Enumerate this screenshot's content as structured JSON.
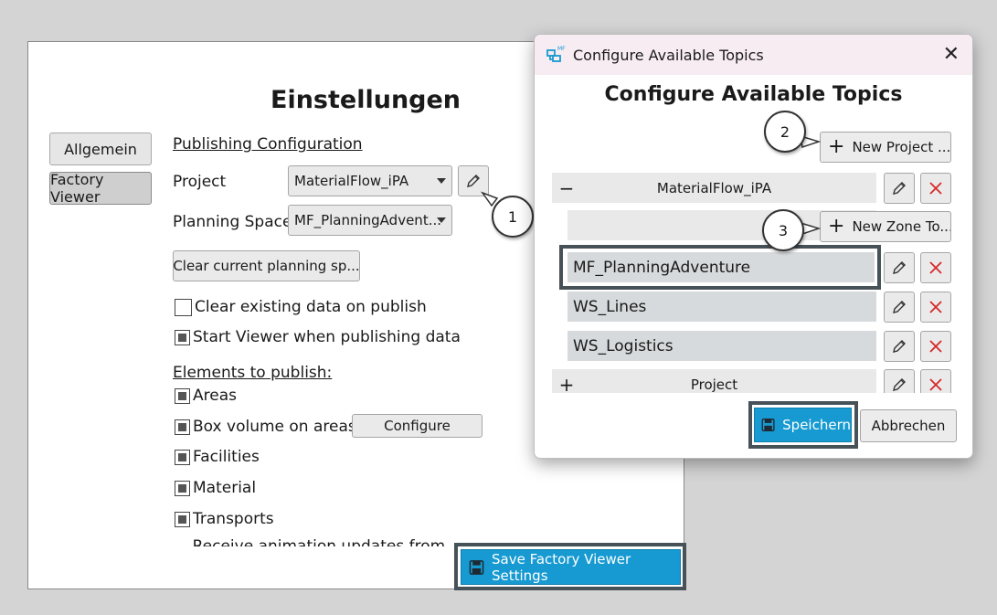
{
  "settings": {
    "title": "Einstellungen",
    "nav": [
      {
        "label": "Allgemein",
        "active": false
      },
      {
        "label": "Factory Viewer",
        "active": true
      }
    ],
    "publishing_header": "Publishing Configuration",
    "project_label": "Project",
    "project_value": "MaterialFlow_iPA",
    "planning_space_label": "Planning Space",
    "planning_space_value": "MF_PlanningAdvent...",
    "clear_planning_button": "Clear current planning sp...",
    "options": [
      {
        "label": "Clear existing data on publish",
        "checked": false
      },
      {
        "label": "Start Viewer when publishing data",
        "checked": true
      }
    ],
    "elements_header": "Elements to publish:",
    "elements": [
      {
        "label": "Areas",
        "checked": true
      },
      {
        "label": "Box volume on areas",
        "checked": true
      },
      {
        "label": "Facilities",
        "checked": true
      },
      {
        "label": "Material",
        "checked": true
      },
      {
        "label": "Transports",
        "checked": true
      },
      {
        "label": "Receive animation updates from Vie",
        "checked": true
      }
    ],
    "configure_button": "Configure",
    "save_button": "Save Factory Viewer Settings"
  },
  "dialog": {
    "window_title": "Configure Available Topics",
    "heading": "Configure Available Topics",
    "new_project_button": "New Project ...",
    "project_group_1": {
      "expander": "−",
      "name": "MaterialFlow_iPA"
    },
    "new_zone_button": "New Zone To...",
    "zones": [
      "MF_PlanningAdventure",
      "WS_Lines",
      "WS_Logistics"
    ],
    "project_group_2": {
      "expander": "+",
      "name": "Project"
    },
    "save_button": "Speichern",
    "cancel_button": "Abbrechen"
  },
  "callouts": [
    "1",
    "2",
    "3"
  ],
  "colors": {
    "accent_blue": "#179ad1",
    "delete_red": "#d62828",
    "highlight_frame": "#465158"
  },
  "icons": {
    "edit": "pencil-icon",
    "delete": "close-x-icon",
    "save": "floppy-disk-icon",
    "app": "mf-app-icon"
  }
}
